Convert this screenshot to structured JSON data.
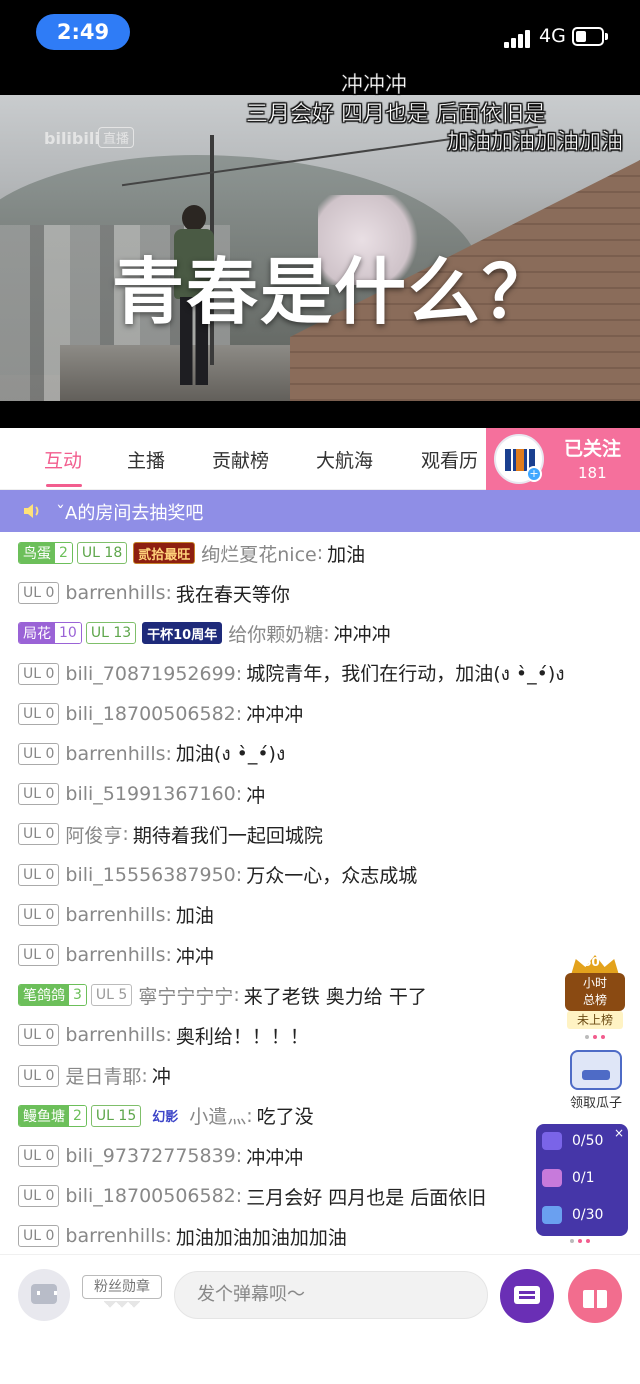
{
  "status_bar": {
    "time": "2:49",
    "network": "4G"
  },
  "video": {
    "logo": "bilibili",
    "live_tag": "直播",
    "title": "青春是什么？",
    "danmaku": [
      "冲冲冲",
      "三月会好 四月也是 后面依旧是",
      "加油加油加油加油"
    ]
  },
  "tabs": [
    "互动",
    "主播",
    "贡献榜",
    "大航海",
    "观看历"
  ],
  "follow": {
    "label": "已关注",
    "count": "181"
  },
  "notice": {
    "text": "ˇA的房间去抽奖吧"
  },
  "chat": [
    {
      "fan_name": "鸟蛋",
      "fan_level": "2",
      "fan_color": "#6cbf5a",
      "ul": "UL 18",
      "ul_style": "green",
      "title": "贰拾最旺",
      "title_style": "red",
      "user": "绚烂夏花nice",
      "message": "加油"
    },
    {
      "ul": "UL 0",
      "user": "barrenhills",
      "message": "我在春天等你"
    },
    {
      "fan_name": "局花",
      "fan_level": "10",
      "fan_color": "#9a63d6",
      "ul": "UL 13",
      "ul_style": "green",
      "title": "干杯10周年",
      "title_style": "navy",
      "user": "给你颗奶糖",
      "message": "冲冲冲"
    },
    {
      "ul": "UL 0",
      "user": "bili_70871952699",
      "message": "城院青年，我们在行动，加油(ง •̀_•́)ง"
    },
    {
      "ul": "UL 0",
      "user": "bili_18700506582",
      "message": "冲冲冲"
    },
    {
      "ul": "UL 0",
      "user": "barrenhills",
      "message": "加油(ง •̀_•́)ง"
    },
    {
      "ul": "UL 0",
      "user": "bili_51991367160",
      "message": "冲"
    },
    {
      "ul": "UL 0",
      "user": "阿俊亨",
      "message": "期待着我们一起回城院"
    },
    {
      "ul": "UL 0",
      "user": "bili_15556387950",
      "message": "万众一心，众志成城"
    },
    {
      "ul": "UL 0",
      "user": "barrenhills",
      "message": "加油"
    },
    {
      "ul": "UL 0",
      "user": "barrenhills",
      "message": "冲冲"
    },
    {
      "fan_name": "笔鸽鸽",
      "fan_level": "3",
      "fan_color": "#6cbf5a",
      "ul": "UL 5",
      "ul_style": "gray",
      "user": "寧宁宁宁宁",
      "message": "来了老铁 奥力给 干了"
    },
    {
      "ul": "UL 0",
      "user": "barrenhills",
      "message": "奥利给！！！！"
    },
    {
      "ul": "UL 0",
      "user": "是日青耶",
      "message": "冲"
    },
    {
      "fan_name": "鳗鱼塘",
      "fan_level": "2",
      "fan_color": "#6cbf5a",
      "ul": "UL 15",
      "ul_style": "green",
      "title": "幻影",
      "title_style": "blue",
      "user": "小遣灬",
      "message": "吃了没"
    },
    {
      "ul": "UL 0",
      "user": "bili_97372775839",
      "message": "冲冲冲"
    },
    {
      "ul": "UL 0",
      "user": "bili_18700506582",
      "message": "三月会好 四月也是 后面依旧"
    },
    {
      "ul": "UL 0",
      "user": "barrenhills",
      "message": "加油加油加油加加油"
    }
  ],
  "rank_widget": {
    "number": "60",
    "label_line1": "小时",
    "label_line2": "总榜",
    "status": "未上榜"
  },
  "melon_widget": {
    "label": "领取瓜子"
  },
  "task_widget": {
    "items": [
      "0/50",
      "0/1",
      "0/30"
    ],
    "icon_colors": [
      "#7a64e8",
      "#c77adb",
      "#6aa0f0"
    ]
  },
  "bottom_bar": {
    "medal_label": "粉丝勋章",
    "input_placeholder": "发个弹幕呗～"
  },
  "colors": {
    "accent": "#f25d8e",
    "notice_bg": "#8f8ee6",
    "task_bg": "#4536a8"
  }
}
